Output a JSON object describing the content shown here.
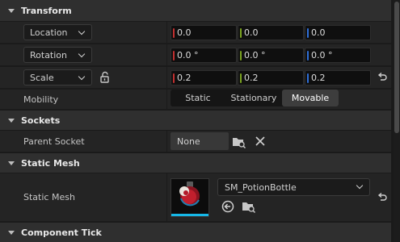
{
  "sections": {
    "transform": "Transform",
    "sockets": "Sockets",
    "static_mesh": "Static Mesh",
    "component_tick": "Component Tick"
  },
  "transform": {
    "location": {
      "label": "Location",
      "x": "0.0",
      "y": "0.0",
      "z": "0.0"
    },
    "rotation": {
      "label": "Rotation",
      "x": "0.0 °",
      "y": "0.0 °",
      "z": "0.0 °"
    },
    "scale": {
      "label": "Scale",
      "x": "0.2",
      "y": "0.2",
      "z": "0.2"
    },
    "mobility": {
      "label": "Mobility",
      "options": [
        "Static",
        "Stationary",
        "Movable"
      ],
      "selected": "Movable"
    }
  },
  "sockets": {
    "parent_socket_label": "Parent Socket",
    "parent_socket_value": "None"
  },
  "static_mesh": {
    "label": "Static Mesh",
    "asset": "SM_PotionBottle"
  },
  "colors": {
    "x_axis": "#c23030",
    "y_axis": "#7aa320",
    "z_axis": "#2f6fd8",
    "thumbnail_underline": "#16b8e8"
  },
  "icons": [
    "chevron-down-icon",
    "lock-open-icon",
    "reset-arrow-icon",
    "browse-folder-icon",
    "clear-x-icon",
    "use-selected-arrow-icon",
    "potion-thumbnail"
  ]
}
